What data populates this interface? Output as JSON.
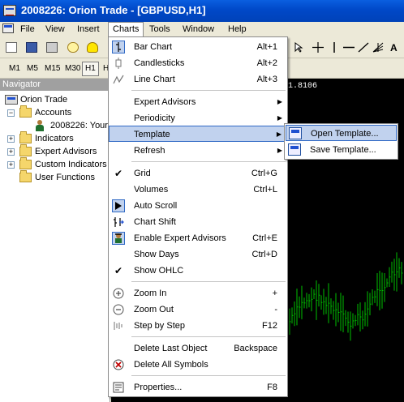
{
  "window": {
    "title": "2008226: Orion Trade - [GBPUSD,H1]"
  },
  "menubar": {
    "items": [
      "File",
      "View",
      "Insert",
      "Charts",
      "Tools",
      "Window",
      "Help"
    ]
  },
  "toolbar2": {
    "timeframes": [
      "M1",
      "M5",
      "M15",
      "M30",
      "H1",
      "H"
    ]
  },
  "navigator": {
    "title": "Navigator",
    "root": "Orion Trade",
    "accounts": "Accounts",
    "account": "2008226: Your",
    "indicators": "Indicators",
    "expert_advisors": "Expert Advisors",
    "custom_indicators": "Custom Indicators",
    "user_functions": "User Functions"
  },
  "chart": {
    "price_label": "1.8106"
  },
  "charts_menu": {
    "bar_chart": {
      "label": "Bar Chart",
      "shortcut": "Alt+1"
    },
    "candlesticks": {
      "label": "Candlesticks",
      "shortcut": "Alt+2"
    },
    "line_chart": {
      "label": "Line Chart",
      "shortcut": "Alt+3"
    },
    "expert_advisors": {
      "label": "Expert Advisors"
    },
    "periodicity": {
      "label": "Periodicity"
    },
    "template": {
      "label": "Template"
    },
    "refresh": {
      "label": "Refresh"
    },
    "grid": {
      "label": "Grid",
      "shortcut": "Ctrl+G"
    },
    "volumes": {
      "label": "Volumes",
      "shortcut": "Ctrl+L"
    },
    "auto_scroll": {
      "label": "Auto Scroll"
    },
    "chart_shift": {
      "label": "Chart Shift"
    },
    "enable_ea": {
      "label": "Enable Expert Advisors",
      "shortcut": "Ctrl+E"
    },
    "show_days": {
      "label": "Show Days",
      "shortcut": "Ctrl+D"
    },
    "show_ohlc": {
      "label": "Show OHLC"
    },
    "zoom_in": {
      "label": "Zoom In",
      "shortcut": "+"
    },
    "zoom_out": {
      "label": "Zoom Out",
      "shortcut": "-"
    },
    "step_by_step": {
      "label": "Step by Step",
      "shortcut": "F12"
    },
    "delete_last": {
      "label": "Delete Last Object",
      "shortcut": "Backspace"
    },
    "delete_all": {
      "label": "Delete All Symbols"
    },
    "properties": {
      "label": "Properties...",
      "shortcut": "F8"
    }
  },
  "template_submenu": {
    "open": "Open Template...",
    "save": "Save Template..."
  },
  "colors": {
    "titlebar": "#0048c8",
    "highlight": "#c1d2ee",
    "chart_bg": "#000000",
    "bars": "#00c000"
  }
}
